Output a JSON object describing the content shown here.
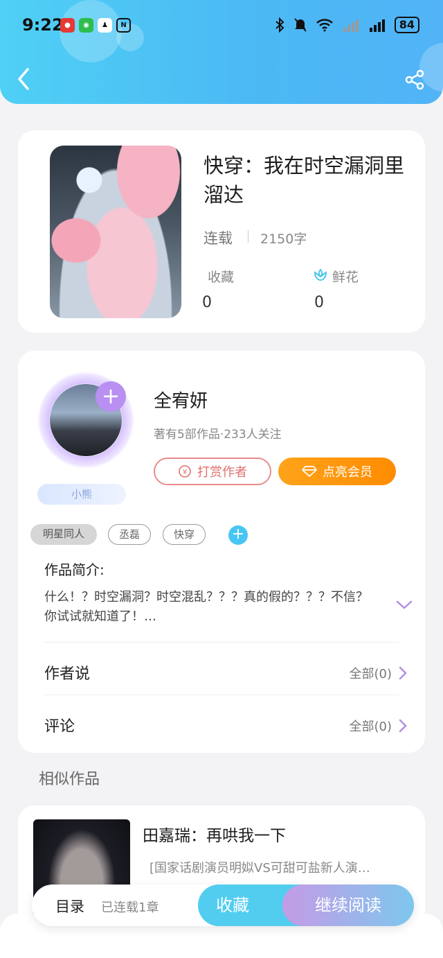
{
  "status_bar": {
    "time": "9:22",
    "app_icons": [
      "meituan-icon",
      "wechat-icon",
      "qq-icon",
      "nfc-icon"
    ],
    "system_icons": [
      "bluetooth-icon",
      "mute-icon",
      "wifi-icon",
      "signal-weak-icon",
      "signal-icon"
    ],
    "battery": "84"
  },
  "header": {
    "back_icon": "chevron-left-icon",
    "share_icon": "share-icon",
    "gradient": [
      "#4fd0f5",
      "#52b4f7"
    ]
  },
  "book": {
    "title": "快穿：我在时空漏洞里溜达",
    "status": "连载",
    "word_count": "2150字",
    "favorites_label": "收藏",
    "favorites_value": "0",
    "flowers_label": "鲜花",
    "flowers_value": "0"
  },
  "author": {
    "name": "全宥妍",
    "meta": "著有5部作品·233人关注",
    "badge": "小熊",
    "reward_label": "打赏作者",
    "vip_label": "点亮会员",
    "tags": [
      "明星同人",
      "丞磊",
      "快穿"
    ]
  },
  "intro": {
    "title": "作品简介:",
    "text": "什么！？时空漏洞？时空混乱？？？真的假的？？？不信？你试试就知道了！…"
  },
  "author_says": {
    "label": "作者说",
    "link": "全部(0)"
  },
  "comments": {
    "label": "评论",
    "link": "全部(0)"
  },
  "similar": {
    "section_title": "相似作品",
    "items": [
      {
        "title": "田嘉瑞：再哄我一下",
        "desc": "[国家话剧演员明姒VS可甜可盐新人演…"
      }
    ]
  },
  "bottom_bar": {
    "toc_label": "目录",
    "toc_status": "已连载1章",
    "favorite_label": "收藏",
    "read_label": "继续阅读"
  },
  "colors": {
    "accent": "#4bc4f2",
    "vip": "#ff9500",
    "reward": "#e26f6f"
  }
}
